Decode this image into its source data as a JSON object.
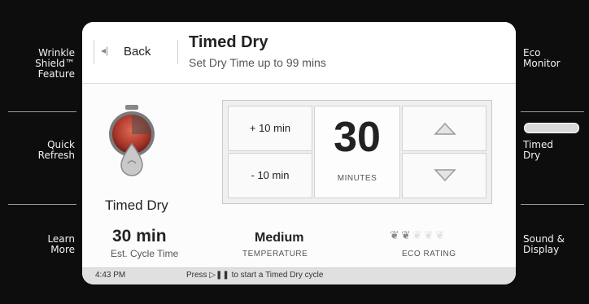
{
  "left_menu": [
    {
      "label": "Wrinkle\nShield™\nFeature"
    },
    {
      "label": "Quick\nRefresh"
    },
    {
      "label": "Learn\nMore"
    }
  ],
  "right_menu": [
    {
      "label": "Eco\nMonitor"
    },
    {
      "label": "Timed\nDry",
      "selected": true
    },
    {
      "label": "Sound &\nDisplay"
    }
  ],
  "header": {
    "back_label": "Back",
    "title": "Timed Dry",
    "subtitle": "Set Dry Time up to 99 mins"
  },
  "mode": {
    "label": "Timed Dry",
    "icon": "timed-dry-knob-icon"
  },
  "time_control": {
    "plus_label": "+ 10 min",
    "minus_label": "- 10 min",
    "value": "30",
    "unit": "MINUTES",
    "up_icon": "arrow-up-icon",
    "down_icon": "arrow-down-icon"
  },
  "stats": {
    "cycle_time_value": "30 min",
    "cycle_time_label": "Est. Cycle Time",
    "temperature_value": "Medium",
    "temperature_label": "TEMPERATURE",
    "eco_label": "ECO RATING",
    "eco_leaves_filled": 2,
    "eco_leaves_total": 5
  },
  "status": {
    "time": "4:43 PM",
    "hint": "Press ▷❚❚ to start a Timed Dry cycle"
  },
  "colors": {
    "bezel": "#0d0d0d",
    "screen": "#fcfcfc",
    "statusbar": "#e0e0e0",
    "knob_red": "#b03a2e"
  }
}
